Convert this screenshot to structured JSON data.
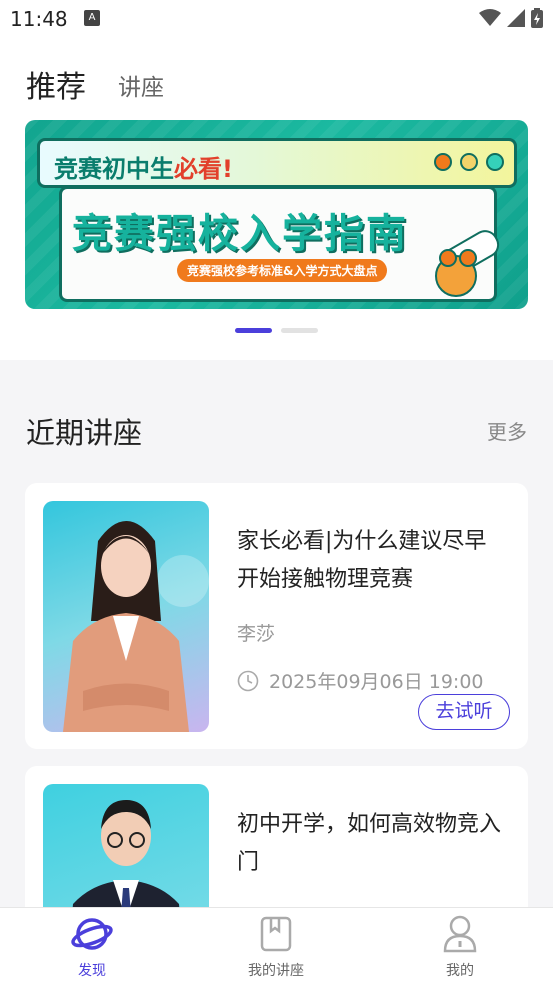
{
  "status": {
    "time": "11:48",
    "notification_letter": "A"
  },
  "header": {
    "tab_recommend": "推荐",
    "tab_lectures": "讲座"
  },
  "banner": {
    "top_text_before": "竞赛初中生",
    "top_text_highlight": "必看!",
    "title": "竞赛强校入学指南",
    "subtitle": "竞赛强校参考标准&入学方式大盘点",
    "dot_colors": [
      "#f07a1c",
      "#f3d36a",
      "#35d0b9"
    ]
  },
  "pager": {
    "page_count": 2,
    "active_index": 0
  },
  "lectures": {
    "title": "近期讲座",
    "more": "更多",
    "cards": [
      {
        "title": "家长必看|为什么建议尽早开始接触物理竞赛",
        "teacher": "李莎",
        "time": "2025年09月06日 19:00",
        "button": "去试听"
      },
      {
        "title": "初中开学，如何高效物竞入门"
      }
    ]
  },
  "tabbar": {
    "items": [
      {
        "label": "发现",
        "icon": "planet-icon"
      },
      {
        "label": "我的讲座",
        "icon": "bookmark-book-icon"
      },
      {
        "label": "我的",
        "icon": "person-icon"
      }
    ],
    "active_index": 0,
    "accent": "#4b3fdb"
  }
}
